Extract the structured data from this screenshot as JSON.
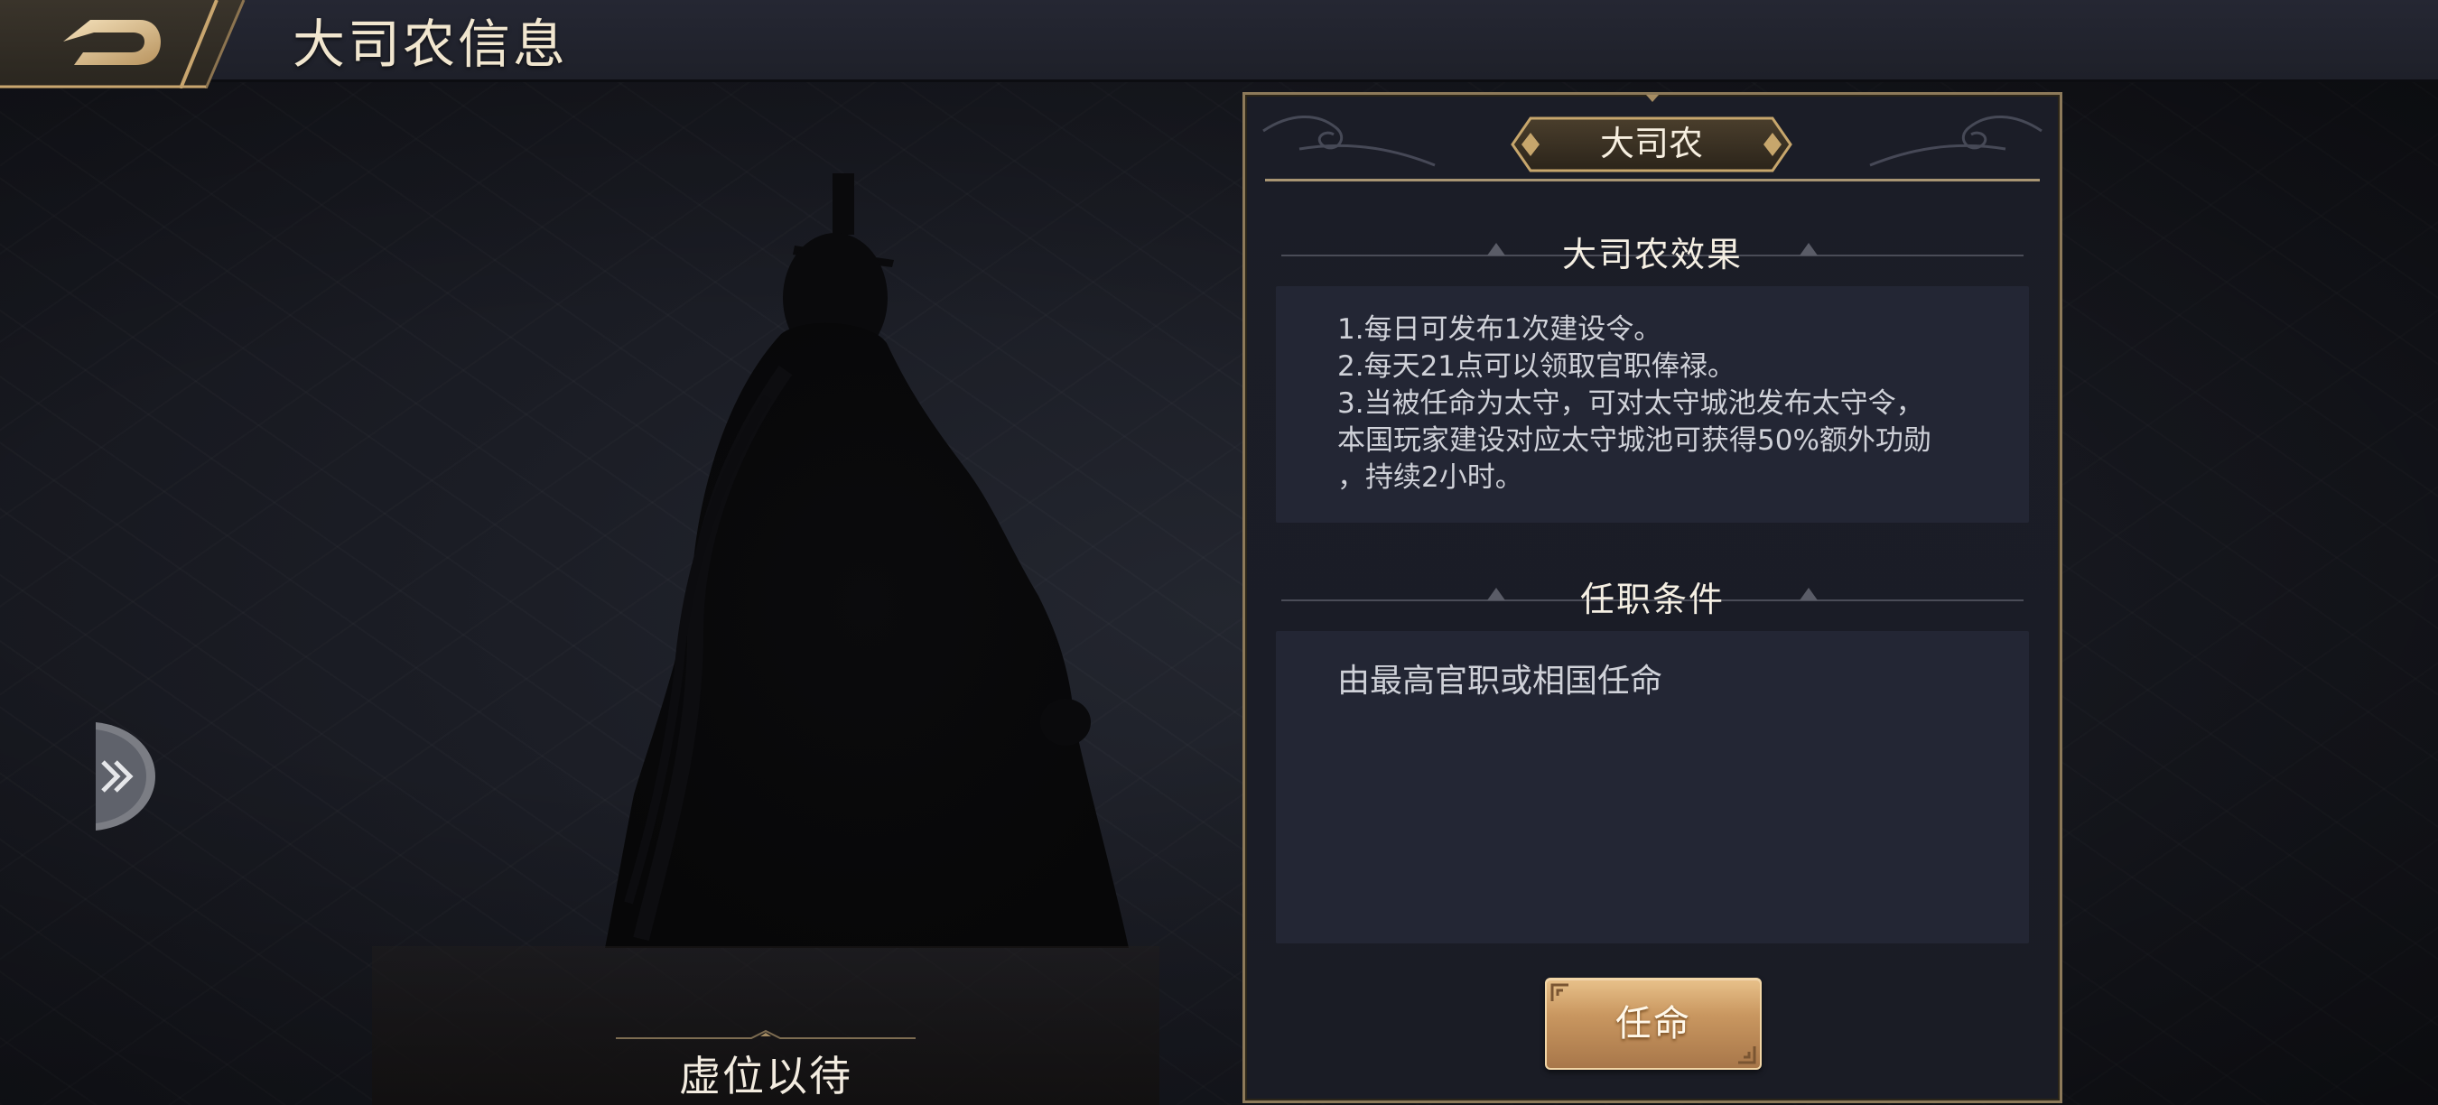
{
  "header": {
    "title": "大司农信息",
    "back_icon": "back-arrow-icon"
  },
  "portrait": {
    "name": "虚位以待",
    "expand_icon": "double-chevron-right-icon"
  },
  "panel": {
    "badge_title": "大司农",
    "effect_section": {
      "title": "大司农效果",
      "lines": [
        "1.每日可发布1次建设令。",
        "2.每天21点可以领取官职俸禄。",
        "3.当被任命为太守，可对太守城池发布太守令，",
        "本国玩家建设对应太守城池可获得50%额外功勋",
        "，持续2小时。"
      ]
    },
    "condition_section": {
      "title": "任职条件",
      "text": "由最高官职或相国任命"
    },
    "appoint_button": "任命"
  },
  "colors": {
    "panel_border": "#8d7a5a",
    "gold_button": "#c99760",
    "text_light": "#f5efe3",
    "text_body": "#cfd1d8"
  }
}
